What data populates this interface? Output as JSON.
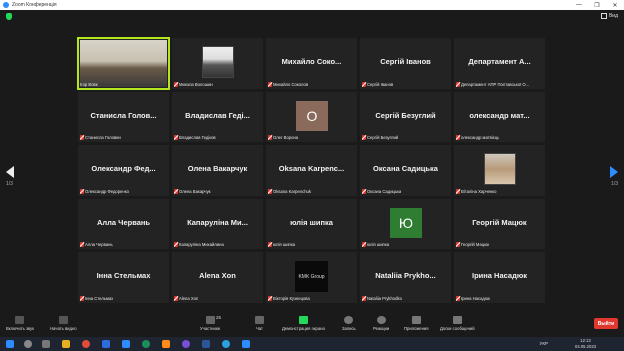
{
  "window": {
    "title": "Zoom Конференція",
    "controls": [
      "—",
      "❐",
      "✕"
    ]
  },
  "topbar": {
    "view_label": "Вид"
  },
  "pagination": {
    "left": "1/3",
    "right": "1/3"
  },
  "tiles": [
    {
      "big": "",
      "small": "Ігор Вовк",
      "type": "video",
      "active": true
    },
    {
      "big": "",
      "small": "Микола Волошин",
      "type": "photo"
    },
    {
      "big": "Михайло Соко...",
      "small": "Михайло Соколов"
    },
    {
      "big": "Сергій Іванов",
      "small": "Сергій Іванов"
    },
    {
      "big": "Департамент А...",
      "small": "Департамент АПР Полтавської О..."
    },
    {
      "big": "Станисла Голов...",
      "small": "Станисла Головин"
    },
    {
      "big": "Владислав Геді...",
      "small": "Владислав Гедіков"
    },
    {
      "big": "",
      "small": "Олег Ворона",
      "type": "avatar",
      "letter": "О",
      "color": "#8a6a5a"
    },
    {
      "big": "Сергій Безуглий",
      "small": "Сергій Безуглий"
    },
    {
      "big": "олександр мат...",
      "small": "олександр матвієць"
    },
    {
      "big": "Олександр Фед...",
      "small": "Олександр Федоренко"
    },
    {
      "big": "Олена Вакарчук",
      "small": "Олена Вакарчук"
    },
    {
      "big": "Oksana Karpenc...",
      "small": "Oksana Karpenchuk"
    },
    {
      "big": "Оксана Садицька",
      "small": "Оксана Садицька"
    },
    {
      "big": "",
      "small": "Віталіна Харченко",
      "type": "photo2"
    },
    {
      "big": "Алла Червань",
      "small": "Алла Червань"
    },
    {
      "big": "Капарулiна Ми...",
      "small": "Капарулiна Михайлина"
    },
    {
      "big": "юлія шипка",
      "small": "юлія шипка"
    },
    {
      "big": "",
      "small": "юлія шипка",
      "type": "avatar",
      "letter": "Ю",
      "color": "#2e7d32"
    },
    {
      "big": "Георгій Мацюк",
      "small": "Георгій Мацюк"
    },
    {
      "big": "Інна Стельмах",
      "small": "Інна Стельмах"
    },
    {
      "big": "Alena Xon",
      "small": "Alena Xon"
    },
    {
      "big": "",
      "small": "Вікторія Кузнецова",
      "type": "logo",
      "logo_text": "KMK Group"
    },
    {
      "big": "Nataliia Prykho...",
      "small": "Nataliia Prykhodko"
    },
    {
      "big": "Ірина Насадюк",
      "small": "Ірина Насадюк"
    }
  ],
  "toolbar": {
    "mute": "Включить звук",
    "video": "Начать видео",
    "participants": "Участники",
    "participants_count": "25",
    "chat": "Чат",
    "share": "Демонстрация экрана",
    "record": "Запись",
    "reactions": "Реакции",
    "apps": "Приложения",
    "whiteboard": "Доски сообщений",
    "leave": "Выйти"
  },
  "taskbar": {
    "lang": "УКР",
    "time": "12:13",
    "date": "04.05.2023"
  },
  "colors": {
    "accent": "#2d8cff",
    "active_speaker": "#b4e61e",
    "leave": "#e0382e",
    "share": "#23d959"
  }
}
